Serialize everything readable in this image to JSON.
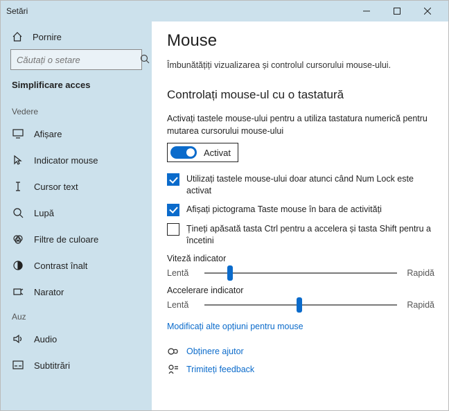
{
  "window": {
    "title": "Setări"
  },
  "sidebar": {
    "home_label": "Pornire",
    "search_placeholder": "Căutați o setare",
    "subheader": "Simplificare acces",
    "sections": {
      "vedere": {
        "label": "Vedere"
      },
      "auz": {
        "label": "Auz"
      }
    },
    "items": {
      "afisare": "Afișare",
      "indicator_mouse": "Indicator mouse",
      "cursor_text": "Cursor text",
      "lupa": "Lupă",
      "filtre_culoare": "Filtre de culoare",
      "contrast_inalt": "Contrast înalt",
      "narator": "Narator",
      "audio": "Audio",
      "subtitrari": "Subtitrări"
    }
  },
  "main": {
    "title": "Mouse",
    "description": "Îmbunătățiți vizualizarea și controlul cursorului mouse-ului.",
    "section_title": "Controlați mouse-ul cu o tastatură",
    "toggle_description": "Activați tastele mouse-ului pentru a utiliza tastatura numerică pentru mutarea cursorului mouse-ului",
    "toggle_state": "Activat",
    "checkbox1": "Utilizați tastele mouse-ului doar atunci când Num Lock este activat",
    "checkbox2": "Afișați pictograma Taste mouse în bara de activități",
    "checkbox3": "Țineți apăsată tasta Ctrl pentru a accelera și tasta Shift pentru a încetini",
    "slider1": {
      "title": "Viteză indicator",
      "left": "Lentă",
      "right": "Rapidă",
      "value_percent": 12
    },
    "slider2": {
      "title": "Accelerare indicator",
      "left": "Lentă",
      "right": "Rapidă",
      "value_percent": 48
    },
    "more_link": "Modificați alte opțiuni pentru mouse",
    "help_link": "Obținere ajutor",
    "feedback_link": "Trimiteți feedback"
  }
}
